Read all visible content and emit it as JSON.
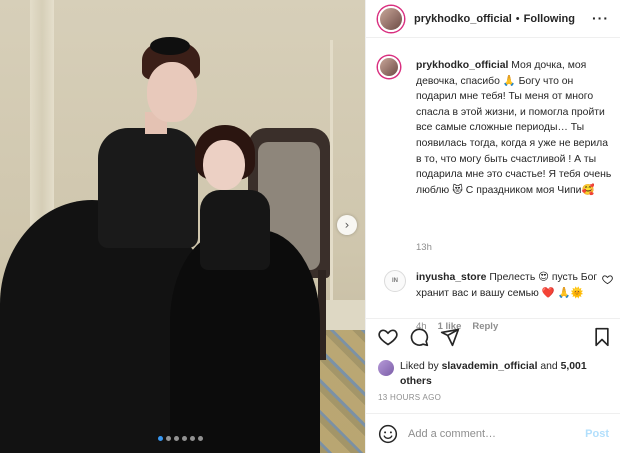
{
  "photo": {
    "alt": "",
    "dots_count": 6,
    "active_dot": 0,
    "next_arrow": "›"
  },
  "header": {
    "username": "prykhodko_official",
    "separator": "•",
    "follow_status": "Following",
    "more_icon": "···"
  },
  "caption": {
    "username": "prykhodko_official",
    "text": "Моя дочка, моя девочка, спасибо 🙏 Богу что он подарил мне тебя! Ты меня от много спасла в этой жизни, и помогла пройти все самые сложные периоды… Ты появилась тогда, когда я уже не верила в то, что могу быть счастливой ! А ты подарила мне это счастье! Я тебя очень люблю 😻 С праздником моя Чипи🥰",
    "time": "13h"
  },
  "comment": {
    "avatar_text": "ІN",
    "username": "inyusha_store",
    "text": "Прелесть 😍 пусть Бог хранит вас и вашу семью ❤️ 🙏🌞",
    "time": "4h",
    "likes": "1 like",
    "reply": "Reply"
  },
  "likes": {
    "prefix": "Liked by",
    "user": "slavademin_official",
    "connector": "and",
    "count": "5,001 others"
  },
  "posted_time": "13 HOURS AGO",
  "add_comment": {
    "placeholder": "Add a comment…",
    "post_label": "Post"
  },
  "colors": {
    "accent": "#3897f0",
    "post_disabled": "#b2dffc",
    "muted": "#8e8e8e",
    "text": "#262626",
    "heart": "#ed4956"
  },
  "icons": [
    "heart-icon",
    "comment-icon",
    "share-icon",
    "bookmark-icon",
    "emoji-icon",
    "more-icon",
    "chevron-right-icon"
  ]
}
